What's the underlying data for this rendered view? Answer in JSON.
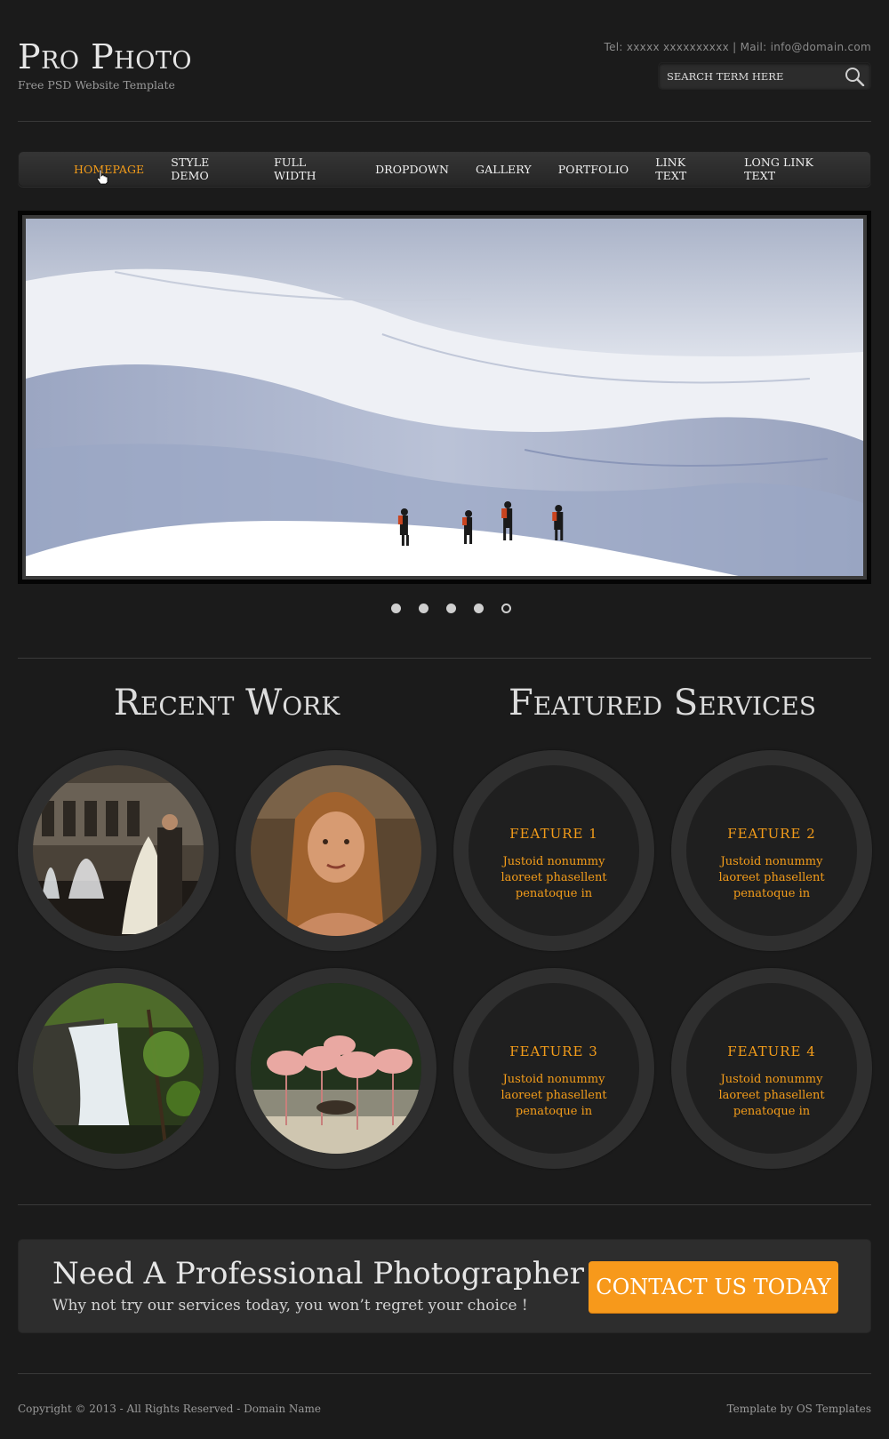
{
  "header": {
    "title": "Pro Photo",
    "tagline": "Free PSD Website Template",
    "contact": "Tel: xxxxx xxxxxxxxxx | Mail: info@domain.com",
    "search_placeholder": "SEARCH TERM HERE",
    "search_icon": "search-icon"
  },
  "nav": {
    "items": [
      {
        "label": "HOMEPAGE",
        "active": true
      },
      {
        "label": "STYLE DEMO"
      },
      {
        "label": "FULL WIDTH"
      },
      {
        "label": "DROPDOWN"
      },
      {
        "label": "GALLERY"
      },
      {
        "label": "PORTFOLIO"
      },
      {
        "label": "LINK TEXT"
      },
      {
        "label": "LONG LINK TEXT"
      }
    ]
  },
  "slider": {
    "slide_count": 5,
    "current_slide": 5
  },
  "recent_work": {
    "title": "Recent Work",
    "items": [
      "wedding-fountain",
      "portrait-woman",
      "waterfall",
      "flamingos"
    ]
  },
  "featured_services": {
    "title": "Featured Services",
    "items": [
      {
        "title": "FEATURE 1",
        "text": "Justoid nonummy laoreet phasellent penatoque in"
      },
      {
        "title": "FEATURE 2",
        "text": "Justoid nonummy laoreet phasellent penatoque in"
      },
      {
        "title": "FEATURE 3",
        "text": "Justoid nonummy laoreet phasellent penatoque in"
      },
      {
        "title": "FEATURE 4",
        "text": "Justoid nonummy laoreet phasellent penatoque in"
      }
    ]
  },
  "cta": {
    "title": "Need A Professional Photographer ?",
    "subtitle": "Why not try our services today, you won’t regret your choice !",
    "button": "CONTACT US TODAY"
  },
  "footer": {
    "left": "Copyright © 2013 - All Rights Reserved - Domain Name",
    "right": "Template by OS Templates"
  },
  "colors": {
    "background": "#1b1b1b",
    "accent": "#f39c1a",
    "button": "#f7991b",
    "panel": "#2d2d2d"
  }
}
